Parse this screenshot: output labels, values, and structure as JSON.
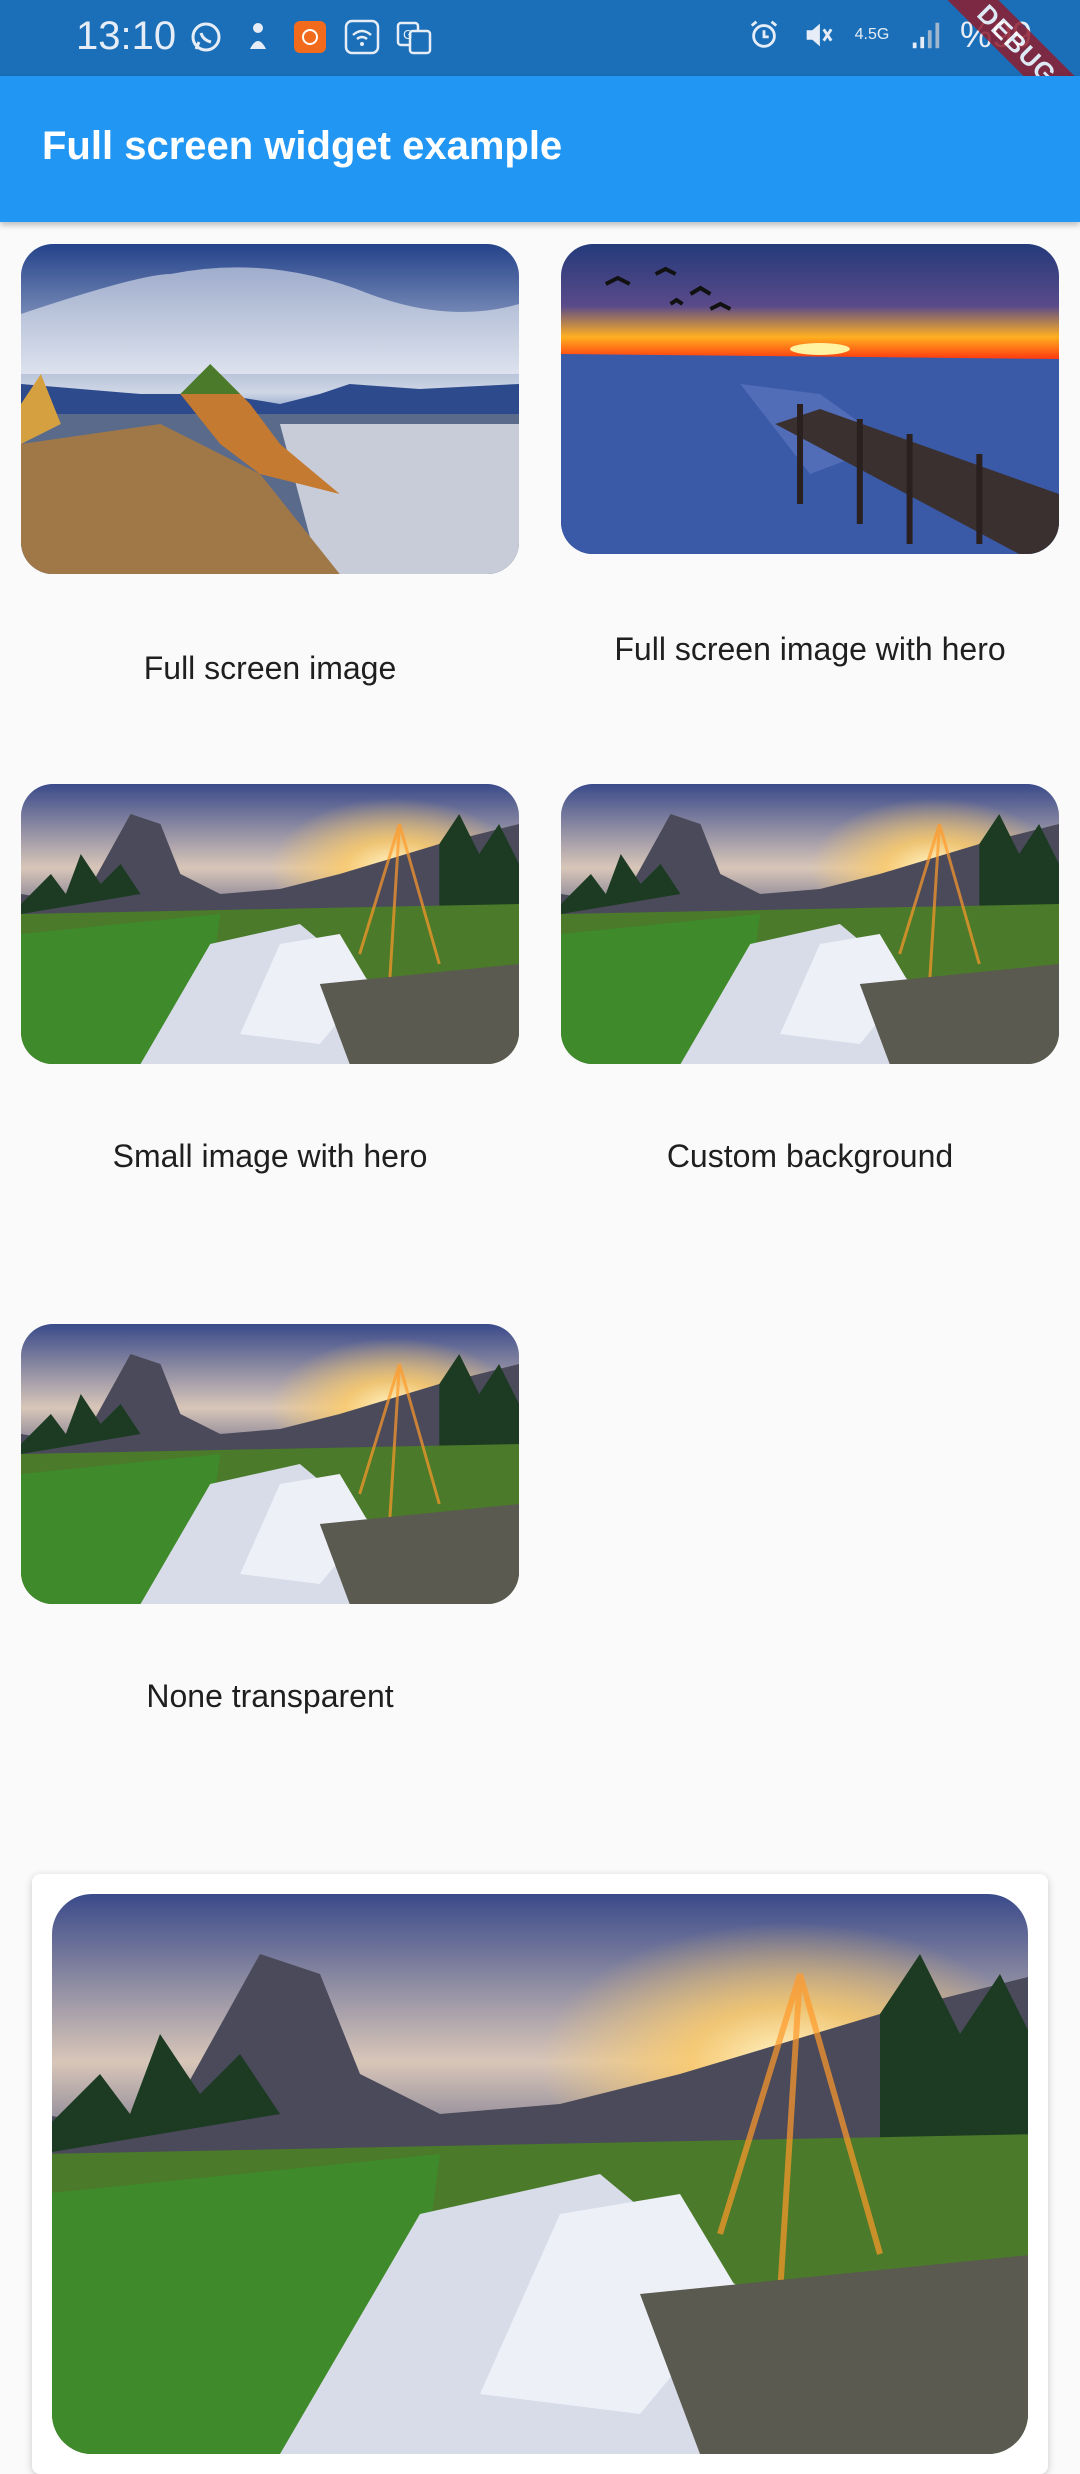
{
  "status_bar": {
    "time": "13:10",
    "battery": "%99",
    "network_label": "4.5G",
    "left_icons": [
      "whatsapp-icon",
      "notification-icon",
      "app-icon",
      "wifi-alert-icon",
      "translate-icon"
    ],
    "right_icons": [
      "alarm-icon",
      "mute-icon",
      "network-icon",
      "signal-icon",
      "battery-icon"
    ]
  },
  "debug_banner": "DEBUG",
  "app_bar": {
    "title": "Full screen widget example"
  },
  "grid": {
    "items": [
      {
        "label": "Full screen image",
        "image": "landscape-road"
      },
      {
        "label": "Full screen image with hero",
        "image": "sunset-pier"
      },
      {
        "label": "Small image with hero",
        "image": "mountain-waterfall"
      },
      {
        "label": "Custom background",
        "image": "mountain-waterfall"
      },
      {
        "label": "None transparent",
        "image": "mountain-waterfall"
      }
    ]
  },
  "colors": {
    "status_bar": "#1a6fb8",
    "app_bar": "#2196f3",
    "background": "#fafafa",
    "debug_banner": "#8e1d2f"
  }
}
